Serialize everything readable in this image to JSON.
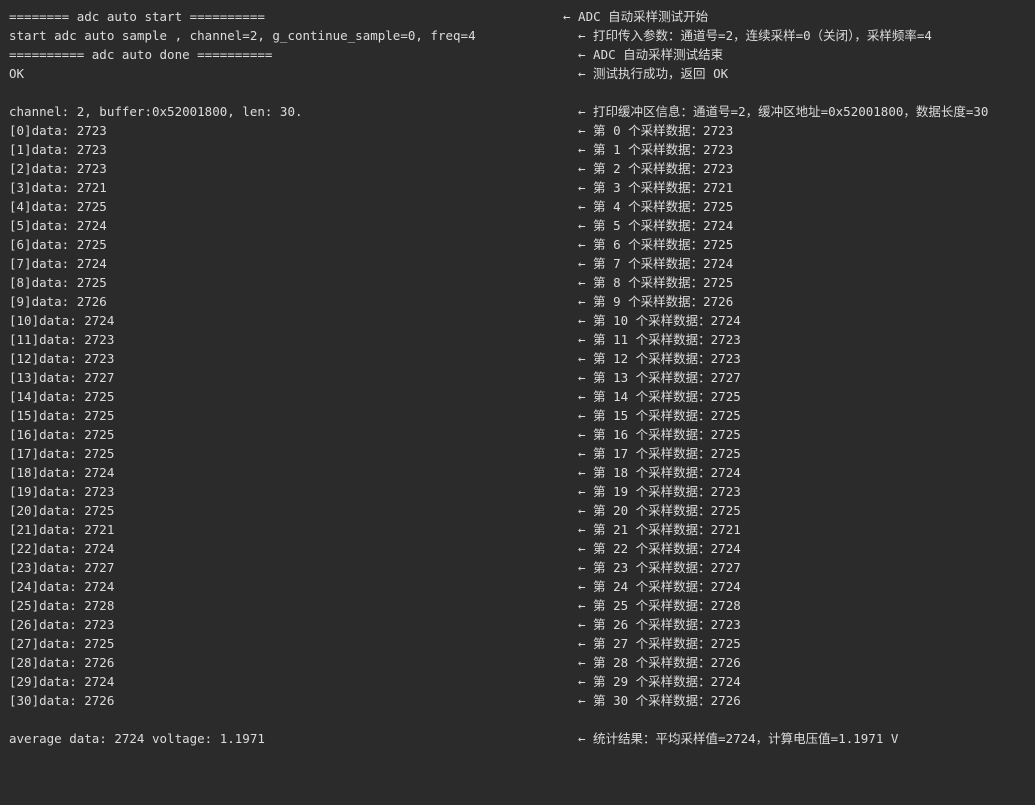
{
  "console": {
    "header_lines": [
      {
        "left": "======== adc auto start ==========",
        "right": "← ADC 自动采样测试开始"
      },
      {
        "left": "start adc auto sample , channel=2, g_continue_sample=0, freq=4",
        "right": "← 打印传入参数：通道号=2，连续采样=0（关闭），采样频率=4"
      },
      {
        "left": "========== adc auto done ==========",
        "right": "← ADC 自动采样测试结束"
      },
      {
        "left": "OK",
        "right": "← 测试执行成功，返回 OK"
      }
    ],
    "buffer_line": {
      "left": "channel: 2, buffer:0x52001800, len: 30.",
      "right": "← 打印缓冲区信息：通道号=2，缓冲区地址=0x52001800，数据长度=30"
    },
    "data_lines": [
      {
        "left": "[0]data: 2723",
        "right": "← 第 0 个采样数据：2723"
      },
      {
        "left": "[1]data: 2723",
        "right": "← 第 1 个采样数据：2723"
      },
      {
        "left": "[2]data: 2723",
        "right": "← 第 2 个采样数据：2723"
      },
      {
        "left": "[3]data: 2721",
        "right": "← 第 3 个采样数据：2721"
      },
      {
        "left": "[4]data: 2725",
        "right": "← 第 4 个采样数据：2725"
      },
      {
        "left": "[5]data: 2724",
        "right": "← 第 5 个采样数据：2724"
      },
      {
        "left": "[6]data: 2725",
        "right": "← 第 6 个采样数据：2725"
      },
      {
        "left": "[7]data: 2724",
        "right": "← 第 7 个采样数据：2724"
      },
      {
        "left": "[8]data: 2725",
        "right": "← 第 8 个采样数据：2725"
      },
      {
        "left": "[9]data: 2726",
        "right": "← 第 9 个采样数据：2726"
      },
      {
        "left": "[10]data: 2724",
        "right": "← 第 10 个采样数据：2724"
      },
      {
        "left": "[11]data: 2723",
        "right": "← 第 11 个采样数据：2723"
      },
      {
        "left": "[12]data: 2723",
        "right": "← 第 12 个采样数据：2723"
      },
      {
        "left": "[13]data: 2727",
        "right": "← 第 13 个采样数据：2727"
      },
      {
        "left": "[14]data: 2725",
        "right": "← 第 14 个采样数据：2725"
      },
      {
        "left": "[15]data: 2725",
        "right": "← 第 15 个采样数据：2725"
      },
      {
        "left": "[16]data: 2725",
        "right": "← 第 16 个采样数据：2725"
      },
      {
        "left": "[17]data: 2725",
        "right": "← 第 17 个采样数据：2725"
      },
      {
        "left": "[18]data: 2724",
        "right": "← 第 18 个采样数据：2724"
      },
      {
        "left": "[19]data: 2723",
        "right": "← 第 19 个采样数据：2723"
      },
      {
        "left": "[20]data: 2725",
        "right": "← 第 20 个采样数据：2725"
      },
      {
        "left": "[21]data: 2721",
        "right": "← 第 21 个采样数据：2721"
      },
      {
        "left": "[22]data: 2724",
        "right": "← 第 22 个采样数据：2724"
      },
      {
        "left": "[23]data: 2727",
        "right": "← 第 23 个采样数据：2727"
      },
      {
        "left": "[24]data: 2724",
        "right": "← 第 24 个采样数据：2724"
      },
      {
        "left": "[25]data: 2728",
        "right": "← 第 25 个采样数据：2728"
      },
      {
        "left": "[26]data: 2723",
        "right": "← 第 26 个采样数据：2723"
      },
      {
        "left": "[27]data: 2725",
        "right": "← 第 27 个采样数据：2725"
      },
      {
        "left": "[28]data: 2726",
        "right": "← 第 28 个采样数据：2726"
      },
      {
        "left": "[29]data: 2724",
        "right": "← 第 29 个采样数据：2724"
      },
      {
        "left": "[30]data: 2726",
        "right": "← 第 30 个采样数据：2726"
      }
    ],
    "average_line": {
      "left": "average data: 2724 voltage: 1.1971",
      "right": "← 统计结果：平均采样值=2724，计算电压值=1.1971 V"
    }
  },
  "colors": {
    "background": "#2b2b2b",
    "text": "#dcdcdc"
  }
}
